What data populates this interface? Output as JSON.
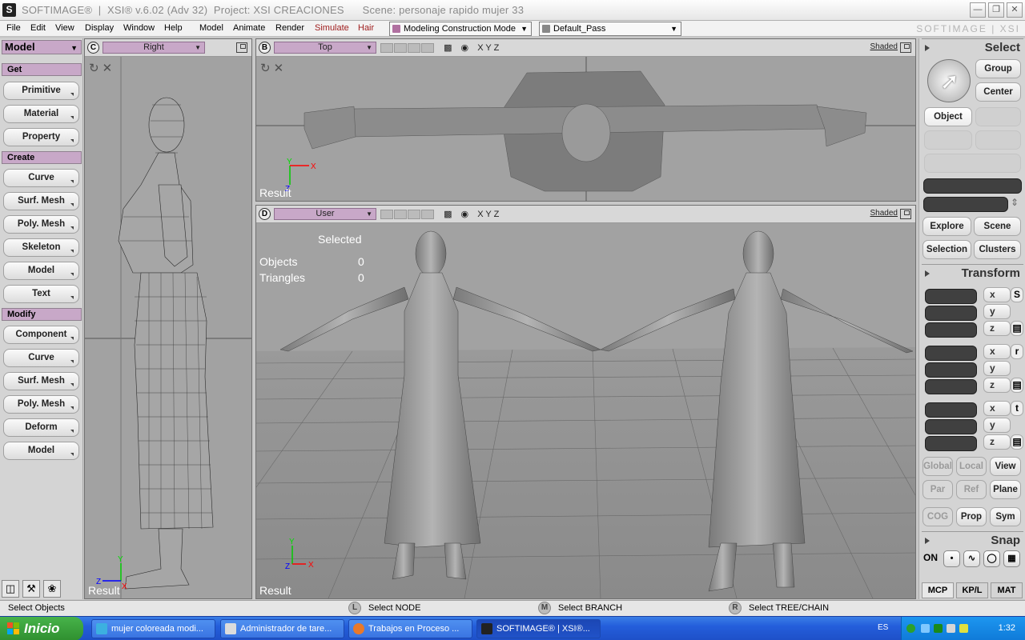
{
  "titlebar": {
    "title": "SOFTIMAGE®  |  XSI® v.6.02 (Adv 32)  Project: XSI CREACIONES      Scene: personaje rapido mujer 33",
    "app_icon": "S"
  },
  "menubar": {
    "items": [
      "File",
      "Edit",
      "View",
      "Display",
      "Window",
      "Help",
      "Model",
      "Animate",
      "Render",
      "Simulate",
      "Hair"
    ],
    "mode_combo": "Modeling Construction Mode",
    "pass_combo": "Default_Pass",
    "brand": "SOFTIMAGE | XSI"
  },
  "left_panel": {
    "module": "Model",
    "sections": [
      {
        "title": "Get",
        "buttons": [
          "Primitive",
          "Material",
          "Property"
        ]
      },
      {
        "title": "Create",
        "buttons": [
          "Curve",
          "Surf. Mesh",
          "Poly. Mesh",
          "Skeleton",
          "Model",
          "Text"
        ]
      },
      {
        "title": "Modify",
        "buttons": [
          "Component",
          "Curve",
          "Surf. Mesh",
          "Poly. Mesh",
          "Deform",
          "Model"
        ]
      }
    ]
  },
  "viewports": {
    "c": {
      "letter": "C",
      "view": "Right",
      "result": "Result"
    },
    "b": {
      "letter": "B",
      "view": "Top",
      "shaded": "Shaded",
      "axes": "X Y Z",
      "result": "Result"
    },
    "d": {
      "letter": "D",
      "view": "User",
      "shaded": "Shaded",
      "axes": "X Y Z",
      "result": "Result",
      "hud": {
        "selected": "Selected",
        "objects_label": "Objects",
        "objects_value": "0",
        "triangles_label": "Triangles",
        "triangles_value": "0"
      }
    }
  },
  "right_panel": {
    "select_title": "Select",
    "group": "Group",
    "center": "Center",
    "object": "Object",
    "explore": "Explore",
    "scene": "Scene",
    "selection": "Selection",
    "clusters": "Clusters",
    "transform_title": "Transform",
    "axes": [
      "x",
      "y",
      "z"
    ],
    "srt": [
      "S",
      "r",
      "t"
    ],
    "global": "Global",
    "local": "Local",
    "view": "View",
    "par": "Par",
    "ref": "Ref",
    "plane": "Plane",
    "cog": "COG",
    "prop": "Prop",
    "sym": "Sym",
    "snap_title": "Snap",
    "snap_on": "ON",
    "mcp": "MCP",
    "kpl": "KP/L",
    "mat": "MAT"
  },
  "statusbar": {
    "left": "Select Objects",
    "l_key": "L",
    "l_text": "Select NODE",
    "m_key": "M",
    "m_text": "Select BRANCH",
    "r_key": "R",
    "r_text": "Select TREE/CHAIN"
  },
  "taskbar": {
    "start": "Inicio",
    "tasks": [
      "mujer coloreada modi...",
      "Administrador de tare...",
      "Trabajos en Proceso ...",
      "SOFTIMAGE® | XSI®..."
    ],
    "lang": "ES",
    "clock": "1:32"
  },
  "colors": {
    "accent_purple": "#c8a8c8",
    "viewport_bg": "#a0a0a0",
    "taskbar_blue": "#245edb",
    "start_green": "#3a9a3c"
  }
}
